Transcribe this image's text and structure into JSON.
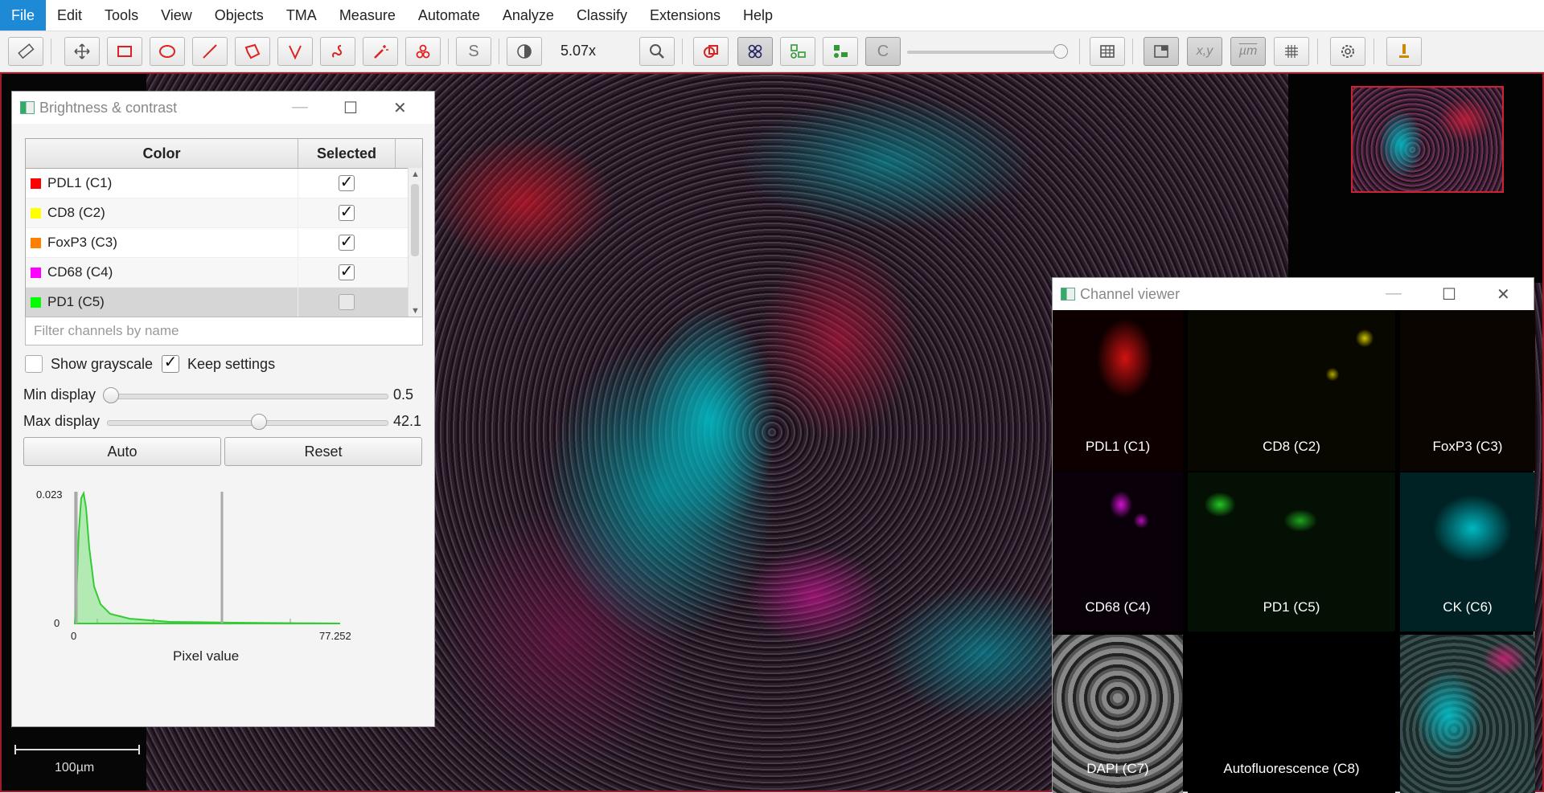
{
  "menu": [
    "File",
    "Edit",
    "Tools",
    "View",
    "Objects",
    "TMA",
    "Measure",
    "Automate",
    "Analyze",
    "Classify",
    "Extensions",
    "Help"
  ],
  "toolbar": {
    "zoom": "5.07x",
    "s_label": "S",
    "c_label": "C",
    "xy_label": "x,y",
    "um_label": "µm"
  },
  "scalebar": {
    "label": "100µm"
  },
  "brightness": {
    "title": "Brightness & contrast",
    "col_color": "Color",
    "col_selected": "Selected",
    "channels": [
      {
        "name": "PDL1 (C1)",
        "color": "#ff0000",
        "selected": "✓"
      },
      {
        "name": "CD8 (C2)",
        "color": "#ffff00",
        "selected": "✓"
      },
      {
        "name": "FoxP3 (C3)",
        "color": "#ff8000",
        "selected": "✓"
      },
      {
        "name": "CD68 (C4)",
        "color": "#ff00ff",
        "selected": "✓"
      },
      {
        "name": "PD1 (C5)",
        "color": "#00ff00",
        "selected": ""
      }
    ],
    "filter_placeholder": "Filter channels by name",
    "show_grayscale": "Show grayscale",
    "keep_settings": "Keep settings",
    "keep_checked": "✓",
    "min_label": "Min display",
    "min_value": "0.5",
    "max_label": "Max display",
    "max_value": "42.1",
    "auto": "Auto",
    "reset": "Reset",
    "histogram": {
      "y_max": "0.023",
      "y_min": "0",
      "x_min": "0",
      "x_max": "77.252",
      "xlabel": "Pixel value"
    }
  },
  "channel_viewer": {
    "title": "Channel viewer",
    "tiles": [
      {
        "label": "PDL1 (C1)"
      },
      {
        "label": "CD8 (C2)"
      },
      {
        "label": "FoxP3 (C3)"
      },
      {
        "label": "CD68 (C4)"
      },
      {
        "label": "PD1 (C5)"
      },
      {
        "label": "CK (C6)"
      },
      {
        "label": "DAPI (C7)"
      },
      {
        "label": "Autofluorescence (C8)"
      },
      {
        "label": ""
      }
    ]
  }
}
